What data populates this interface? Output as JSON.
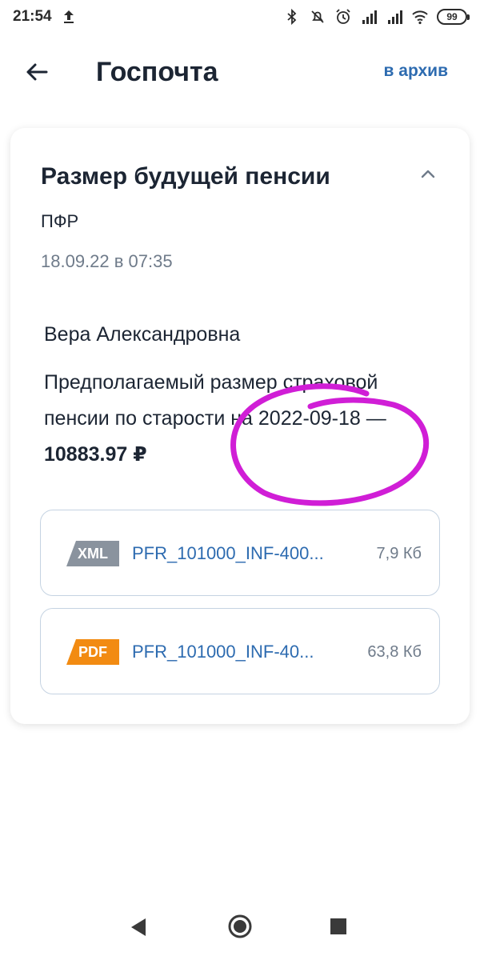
{
  "status_bar": {
    "time": "21:54",
    "icons": [
      "upload-arrow-icon",
      "bluetooth-icon",
      "mute-icon",
      "alarm-icon",
      "signal-icon",
      "signal-icon",
      "wifi-icon"
    ],
    "battery": "99"
  },
  "header": {
    "title": "Госпочта",
    "archive_label": "в архив"
  },
  "message": {
    "title": "Размер будущей пенсии",
    "sender": "ПФР",
    "datetime": "18.09.22 в 07:35",
    "recipient": "Вера Александровна",
    "body_text": "Предполагаемый размер страховой пенсии по старости на 2022-09-18 — ",
    "amount": "10883.97 ₽",
    "highlight_color": "#d01ed6"
  },
  "attachments": [
    {
      "type": "XML",
      "name": "PFR_101000_INF-400...",
      "size": "7,9 Кб",
      "badge_color": "#8a939e"
    },
    {
      "type": "PDF",
      "name": "PFR_101000_INF-40...",
      "size": "63,8 Кб",
      "badge_color": "#f28b12"
    }
  ],
  "colors": {
    "accent": "#2d6bb0",
    "text": "#1c2533",
    "muted": "#6f7b8a",
    "border": "#c5d3e2"
  }
}
